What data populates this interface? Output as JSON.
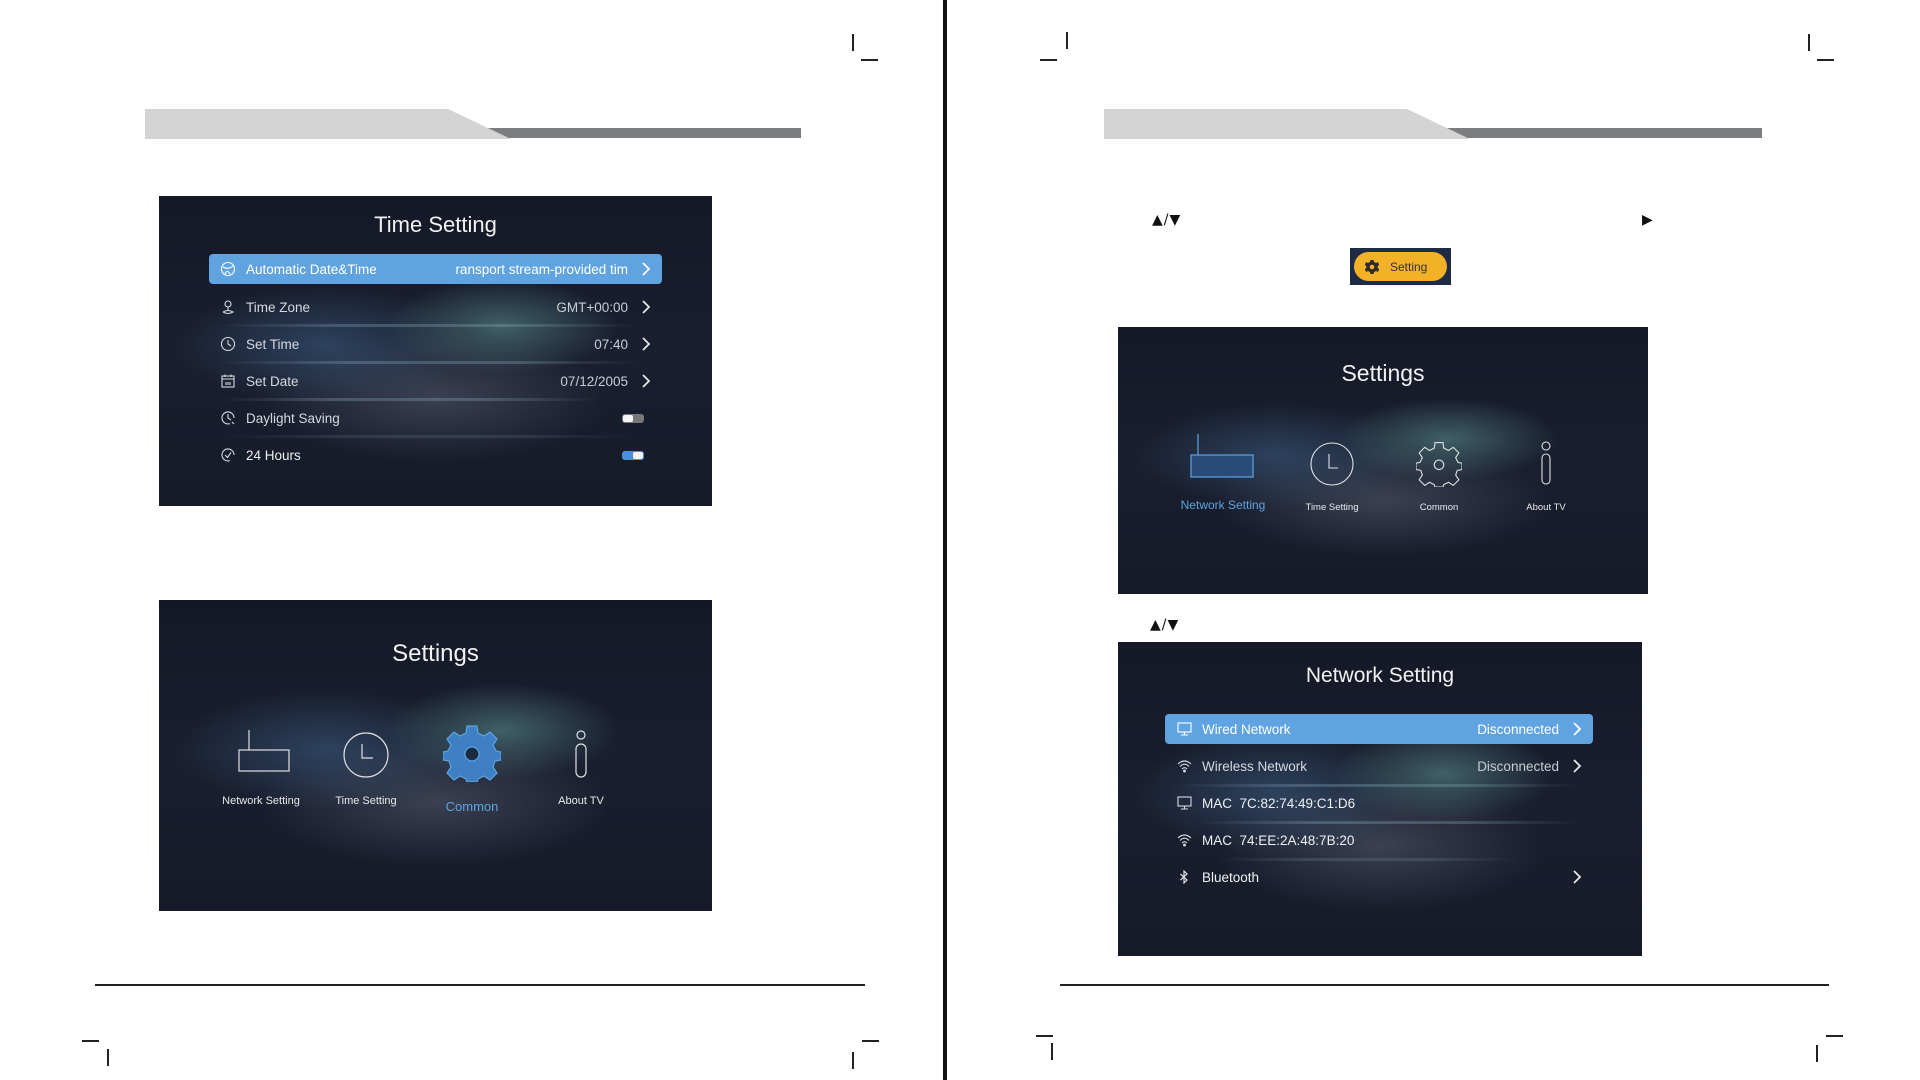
{
  "left_page": {
    "time_setting": {
      "title": "Time Setting",
      "rows": [
        {
          "icon": "globe-clock-icon",
          "label": "Automatic Date&Time",
          "value": "ransport stream-provided tim",
          "control": "chevron",
          "selected": true
        },
        {
          "icon": "map-pin-icon",
          "label": "Time Zone",
          "value": "GMT+00:00",
          "control": "chevron",
          "selected": false
        },
        {
          "icon": "clock-icon",
          "label": "Set Time",
          "value": "07:40",
          "control": "chevron",
          "selected": false
        },
        {
          "icon": "calendar-icon",
          "label": "Set Date",
          "value": "07/12/2005",
          "control": "chevron",
          "selected": false
        },
        {
          "icon": "daylight-clock-icon",
          "label": "Daylight Saving",
          "value": "",
          "control": "toggle",
          "toggle_on": false,
          "selected": false
        },
        {
          "icon": "check-clock-icon",
          "label": "24 Hours",
          "value": "",
          "control": "toggle",
          "toggle_on": true,
          "selected": false
        }
      ]
    },
    "settings_menu": {
      "title": "Settings",
      "tiles": [
        {
          "icon": "network-router-icon",
          "label": "Network Setting",
          "active": false
        },
        {
          "icon": "clock-icon",
          "label": "Time Setting",
          "active": false
        },
        {
          "icon": "gear-icon",
          "label": "Common",
          "active": true
        },
        {
          "icon": "info-icon",
          "label": "About TV",
          "active": false
        }
      ]
    }
  },
  "right_page": {
    "nav_hint_1": "▲/▼",
    "nav_hint_right": "▶",
    "setting_button": {
      "icon": "gear-icon",
      "label": "Setting"
    },
    "settings_menu": {
      "title": "Settings",
      "tiles": [
        {
          "icon": "network-router-icon",
          "label": "Network Setting",
          "active": true
        },
        {
          "icon": "clock-icon",
          "label": "Time Setting",
          "active": false
        },
        {
          "icon": "gear-icon",
          "label": "Common",
          "active": false
        },
        {
          "icon": "info-icon",
          "label": "About TV",
          "active": false
        }
      ]
    },
    "nav_hint_2": "▲/▼",
    "network_setting": {
      "title": "Network Setting",
      "rows": [
        {
          "icon": "monitor-icon",
          "label": "Wired Network",
          "value": "Disconnected",
          "control": "chevron",
          "selected": true
        },
        {
          "icon": "wifi-icon",
          "label": "Wireless Network",
          "value": "Disconnected",
          "control": "chevron",
          "selected": false
        },
        {
          "icon": "monitor-icon",
          "label": "MAC  7C:82:74:49:C1:D6",
          "value": "",
          "control": "none",
          "selected": false
        },
        {
          "icon": "wifi-icon",
          "label": "MAC  74:EE:2A:48:7B:20",
          "value": "",
          "control": "none",
          "selected": false
        },
        {
          "icon": "bluetooth-icon",
          "label": "Bluetooth",
          "value": "",
          "control": "chevron",
          "selected": false
        }
      ]
    }
  },
  "colors": {
    "accent_blue": "#5fa4e0",
    "setting_button_yellow": "#f2b126",
    "header_light_gray": "#d4d4d4",
    "header_dark_gray": "#7b7d7f"
  }
}
